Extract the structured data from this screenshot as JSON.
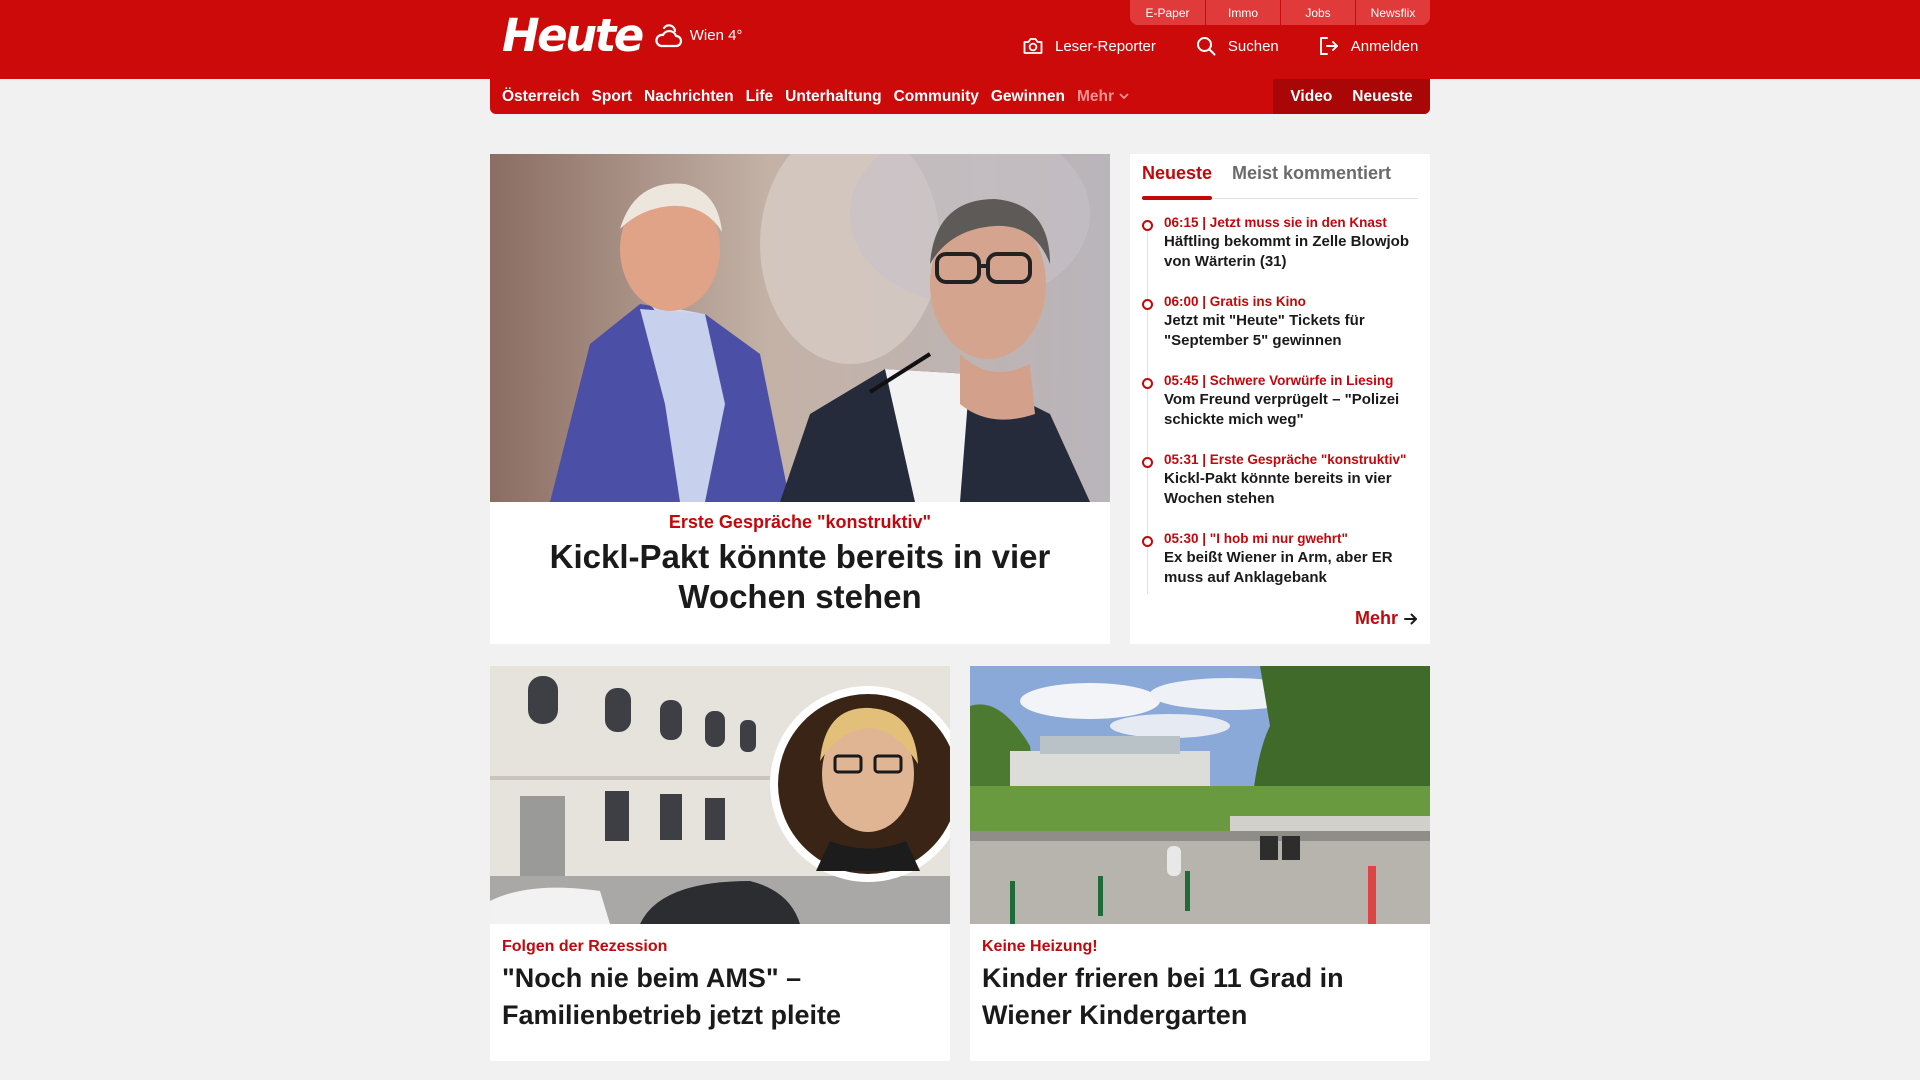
{
  "header": {
    "logo": "Heute",
    "weather": "Wien 4°",
    "util_tabs": [
      "E-Paper",
      "Immo",
      "Jobs",
      "Newsflix"
    ],
    "actions": {
      "reporter": "Leser-Reporter",
      "search": "Suchen",
      "login": "Anmelden"
    }
  },
  "nav": {
    "items": [
      "Österreich",
      "Sport",
      "Nachrichten",
      "Life",
      "Unterhaltung",
      "Community",
      "Gewinnen"
    ],
    "more": "Mehr",
    "video": "Video",
    "newest": "Neueste"
  },
  "hero": {
    "kicker": "Erste Gespräche \"konstruktiv\"",
    "title": "Kickl-Pakt könnte bereits in vier Wochen stehen"
  },
  "sidebar": {
    "tab_active": "Neueste",
    "tab_inactive": "Meist kommentiert",
    "items": [
      {
        "meta": "06:15 | Jetzt muss sie in den Knast",
        "title": "Häftling bekommt in Zelle Blowjob von Wärterin (31)"
      },
      {
        "meta": "06:00 | Gratis ins Kino",
        "title": "Jetzt mit \"Heute\" Tickets für \"September 5\" gewinnen"
      },
      {
        "meta": "05:45 | Schwere Vorwürfe in Liesing",
        "title": "Vom Freund verprügelt – \"Polizei schickte mich weg\""
      },
      {
        "meta": "05:31 | Erste Gespräche \"konstruktiv\"",
        "title": "Kickl-Pakt könnte bereits in vier Wochen stehen"
      },
      {
        "meta": "05:30 | \"I hob mi nur gwehrt\"",
        "title": "Ex beißt Wiener in Arm, aber ER muss auf Anklagebank"
      }
    ],
    "more": "Mehr"
  },
  "cards": [
    {
      "kicker": "Folgen der Rezession",
      "title": "\"Noch nie beim AMS\" – Familienbetrieb jetzt pleite"
    },
    {
      "kicker": "Keine Heizung!",
      "title": "Kinder frieren bei 11 Grad in Wiener Kindergarten"
    }
  ]
}
